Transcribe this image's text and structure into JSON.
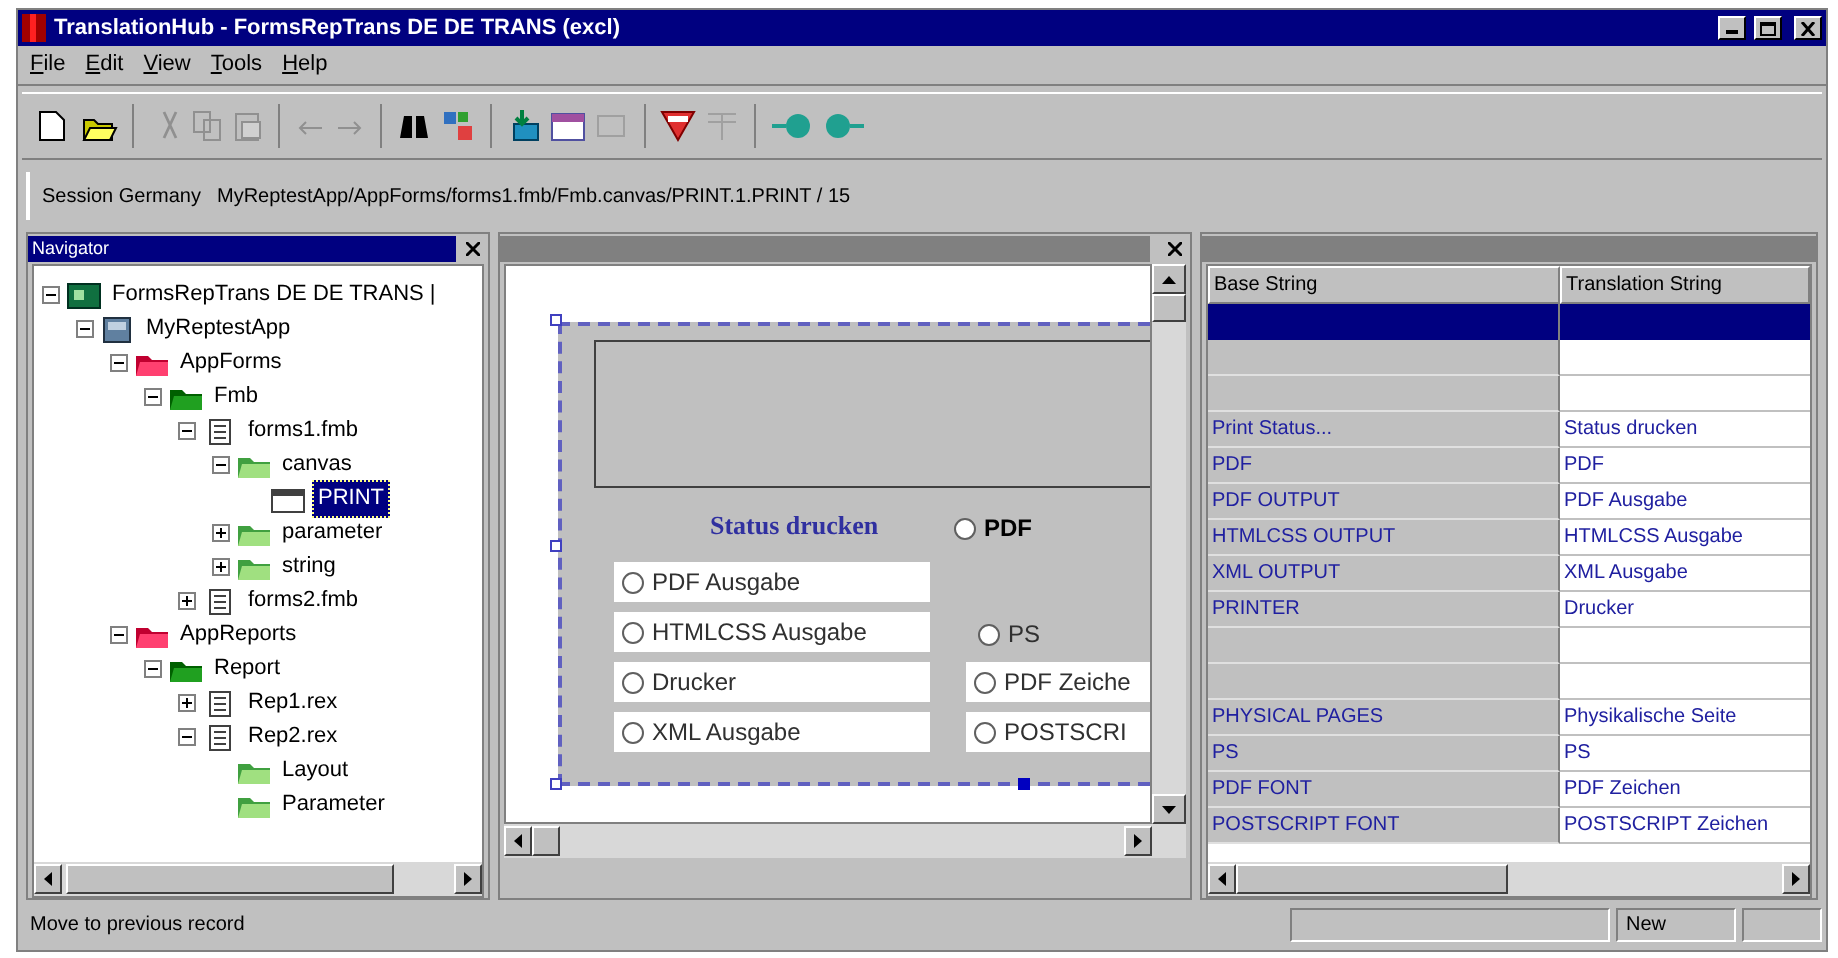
{
  "window": {
    "title": "TranslationHub - FormsRepTrans DE DE TRANS (excl)"
  },
  "menu": [
    {
      "label": "File"
    },
    {
      "label": "Edit"
    },
    {
      "label": "View"
    },
    {
      "label": "Tools"
    },
    {
      "label": "Help"
    }
  ],
  "path_bar": {
    "session": "Session Germany",
    "path": "MyReptestApp/AppForms/forms1.fmb/Fmb.canvas/PRINT.1.PRINT / 15"
  },
  "navigator": {
    "title": "Navigator",
    "tree": [
      {
        "label": "FormsRepTrans DE DE TRANS |",
        "kind": "project",
        "expanded": true,
        "selected": false,
        "children": [
          {
            "label": "MyReptestApp",
            "kind": "app",
            "expanded": true,
            "selected": false,
            "children": [
              {
                "label": "AppForms",
                "kind": "folder-red",
                "expanded": true,
                "selected": false,
                "children": [
                  {
                    "label": "Fmb",
                    "kind": "folder-green",
                    "expanded": true,
                    "selected": false,
                    "children": [
                      {
                        "label": "forms1.fmb",
                        "kind": "file",
                        "expanded": true,
                        "selected": false,
                        "children": [
                          {
                            "label": "canvas",
                            "kind": "folder-light",
                            "expanded": true,
                            "selected": false,
                            "children": [
                              {
                                "label": "PRINT",
                                "kind": "canvas",
                                "selected": true
                              }
                            ]
                          },
                          {
                            "label": "parameter",
                            "kind": "folder-light",
                            "expanded": false,
                            "selected": false
                          },
                          {
                            "label": "string",
                            "kind": "folder-light",
                            "expanded": false,
                            "selected": false
                          }
                        ]
                      },
                      {
                        "label": "forms2.fmb",
                        "kind": "file",
                        "expanded": false,
                        "selected": false
                      }
                    ]
                  }
                ]
              },
              {
                "label": "AppReports",
                "kind": "folder-red",
                "expanded": true,
                "selected": false,
                "children": [
                  {
                    "label": "Report",
                    "kind": "folder-green",
                    "expanded": true,
                    "selected": false,
                    "children": [
                      {
                        "label": "Rep1.rex",
                        "kind": "file",
                        "expanded": false,
                        "selected": false
                      },
                      {
                        "label": "Rep2.rex",
                        "kind": "file",
                        "expanded": true,
                        "selected": false,
                        "children": [
                          {
                            "label": "Layout",
                            "kind": "folder-light",
                            "selected": false
                          },
                          {
                            "label": "Parameter",
                            "kind": "folder-light",
                            "selected": false
                          }
                        ]
                      }
                    ]
                  }
                ]
              }
            ]
          }
        ]
      }
    ]
  },
  "layout": {
    "label": "Status drucken",
    "radios": [
      {
        "label": "PDF",
        "kind": "plain",
        "checked": false
      },
      {
        "label": "PDF Ausgabe",
        "kind": "boxed",
        "checked": false
      },
      {
        "label": "HTMLCSS Ausgabe",
        "kind": "boxed",
        "checked": false
      },
      {
        "label": "Drucker",
        "kind": "boxed",
        "checked": false
      },
      {
        "label": "XML Ausgabe",
        "kind": "boxed",
        "checked": false
      },
      {
        "label": "PS",
        "kind": "plain",
        "checked": false
      },
      {
        "label": "PDF Zeiche",
        "kind": "boxed",
        "checked": false
      },
      {
        "label": "POSTSCRI",
        "kind": "boxed",
        "checked": false
      }
    ]
  },
  "grid": {
    "columns": [
      "Base String",
      "Translation String"
    ],
    "rows": [
      {
        "selected": true
      },
      {
        "selected": false
      },
      {
        "selected": false
      },
      {
        "base": "Print Status...",
        "translation": "Status drucken",
        "selected": false
      },
      {
        "base": "PDF",
        "translation": "PDF",
        "selected": false
      },
      {
        "base": "PDF OUTPUT",
        "translation": "PDF Ausgabe",
        "selected": false
      },
      {
        "base": "HTMLCSS OUTPUT",
        "translation": "HTMLCSS Ausgabe",
        "selected": false
      },
      {
        "base": "XML OUTPUT",
        "translation": "XML Ausgabe",
        "selected": false
      },
      {
        "base": "PRINTER",
        "translation": "Drucker",
        "selected": false
      },
      {
        "selected": false
      },
      {
        "selected": false
      },
      {
        "base": "PHYSICAL PAGES",
        "translation": "Physikalische Seite",
        "selected": false
      },
      {
        "base": "PS",
        "translation": "PS",
        "selected": false
      },
      {
        "base": "PDF FONT",
        "translation": "PDF Zeichen",
        "selected": false
      },
      {
        "base": "POSTSCRIPT FONT",
        "translation": "POSTSCRIPT Zeichen",
        "selected": false
      }
    ]
  },
  "status_bar": {
    "message": "Move to previous record",
    "mode": "New"
  }
}
